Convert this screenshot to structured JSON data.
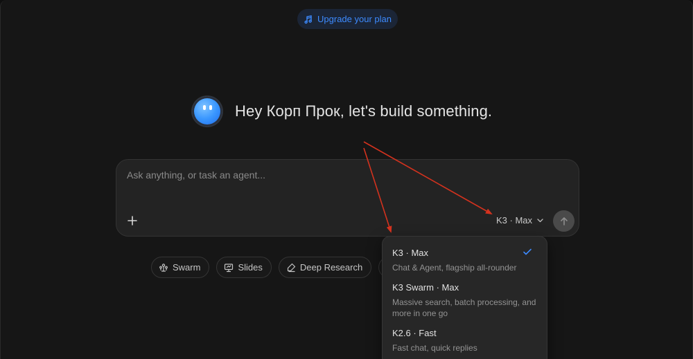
{
  "topbar": {
    "upgrade_label": "Upgrade your plan"
  },
  "greeting": {
    "text": "Hey Корп Прок, let's build something."
  },
  "composer": {
    "placeholder": "Ask anything, or task an agent...",
    "selected_model": "K3 · Max"
  },
  "chips": [
    {
      "label": "Swarm",
      "icon": "swarm-icon"
    },
    {
      "label": "Slides",
      "icon": "slides-icon"
    },
    {
      "label": "Deep Research",
      "icon": "research-icon"
    }
  ],
  "model_menu": {
    "options": [
      {
        "name": "K3 · Max",
        "desc": "Chat & Agent, flagship all-rounder",
        "selected": true
      },
      {
        "name": "K3 Swarm · Max",
        "desc": "Massive search, batch processing, and more in one go",
        "selected": false
      },
      {
        "name": "K2.6 · Fast",
        "desc": "Fast chat, quick replies",
        "selected": false
      }
    ]
  },
  "colors": {
    "accent": "#3d8bff",
    "annotation_arrow": "#d4321e",
    "background": "#161616"
  }
}
